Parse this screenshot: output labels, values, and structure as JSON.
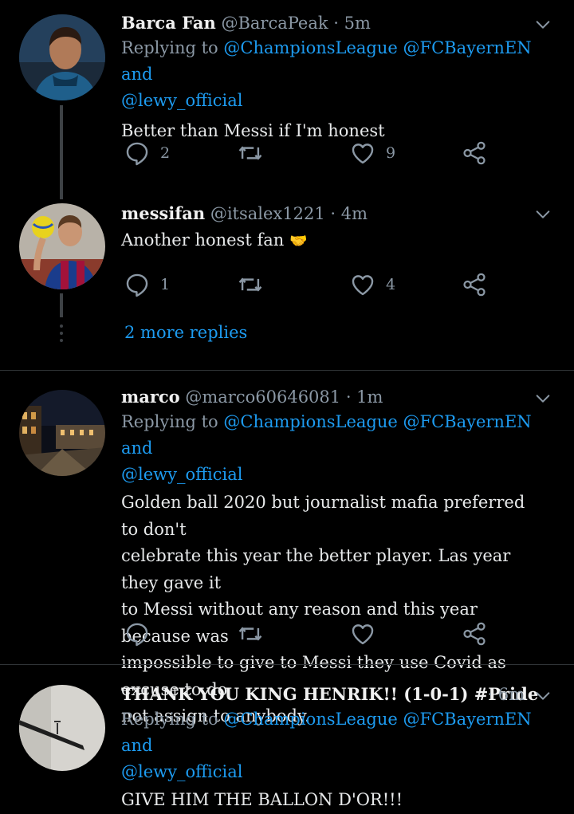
{
  "tweets": [
    {
      "name": "Barca Fan",
      "handle": "@BarcaPeak",
      "time": "· 5m",
      "replying_prefix": "Replying to",
      "mentions": [
        "@ChampionsLeague",
        "@FCBayernEN",
        "@lewy_official"
      ],
      "and_word": "and",
      "text": "Better than Messi if I'm honest",
      "replies": "2",
      "retweets": "",
      "likes": "9",
      "avatar": "player-photo-avatar"
    },
    {
      "name": "messifan",
      "handle": "@itsalex1221",
      "time": "· 4m",
      "text": "Another honest fan",
      "emoji": "🤝",
      "replies": "1",
      "retweets": "",
      "likes": "4",
      "avatar": "player-with-ball-avatar"
    },
    {
      "name": "marco",
      "handle": "@marco60646081",
      "time": "· 1m",
      "replying_prefix": "Replying to",
      "mentions": [
        "@ChampionsLeague",
        "@FCBayernEN",
        "@lewy_official"
      ],
      "and_word": "and",
      "text_lines": [
        "Golden ball 2020 but journalist mafia preferred to don't",
        "celebrate this year the better player. Las year they gave it",
        "to Messi without any reason and this year because was",
        "impossible to give to Messi they use Covid as excuse to do",
        "not assign to anybody."
      ],
      "replies": "",
      "retweets": "",
      "likes": "",
      "avatar": "night-street-avatar"
    },
    {
      "name": "THANK YOU KING HENRIK!! (1-0-1) #Pride #B...",
      "handle": "",
      "time": "· 6m",
      "replying_prefix": "Replying to",
      "mentions": [
        "@ChampionsLeague",
        "@FCBayernEN",
        "@lewy_official"
      ],
      "and_word": "and",
      "text": "GIVE HIM THE BALLON D'OR!!!",
      "avatar": "wall-shelf-avatar"
    }
  ],
  "thread": {
    "more_replies": "2 more replies"
  },
  "colors": {
    "background": "#000000",
    "link": "#1d9bf0",
    "muted": "#8b98a5",
    "text": "#e7e9ea"
  },
  "icons": [
    "reply-icon",
    "retweet-icon",
    "like-icon",
    "share-icon",
    "chevron-down-icon"
  ]
}
